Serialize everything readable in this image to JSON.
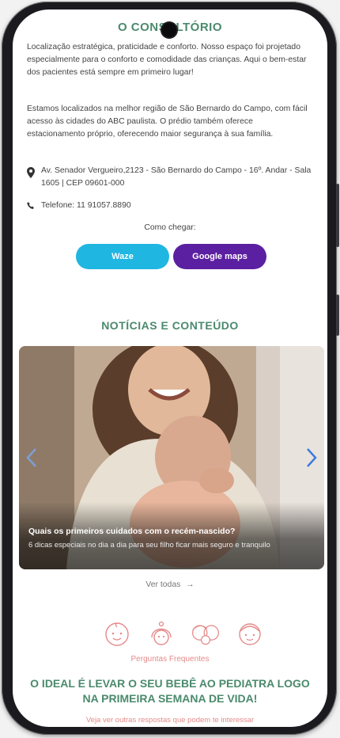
{
  "consultorio": {
    "title": "O CONSULTÓRIO",
    "p1": "Localização estratégica, praticidade e conforto. Nosso espaço foi projetado especialmente para o conforto e comodidade das crianças. Aqui o bem-estar dos pacientes está sempre em primeiro lugar!",
    "p2": "Estamos localizados na melhor região de São Bernardo do Campo, com fácil acesso às cidades do ABC paulista. O prédio também oferece estacionamento próprio, oferecendo maior segurança à sua família.",
    "address": "Av. Senador Vergueiro,2123 - São Bernardo do Campo - 16º. Andar - Sala 1605 | CEP 09601-000",
    "phone": "Telefone: 11 91057.8890",
    "how_to": "Como chegar:",
    "waze_label": "Waze",
    "maps_label": "Google maps"
  },
  "news": {
    "title": "NOTÍCIAS E CONTEÚDO",
    "card_title": "Quais os primeiros cuidados com o recém-nascido?",
    "card_desc": "6 dicas especiais no dia a dia para seu filho ficar mais seguro e tranquilo",
    "see_all": "Ver todas",
    "see_all_arrow": "→"
  },
  "faq": {
    "label": "Perguntas Frequentes",
    "headline": "O IDEAL É LEVAR O SEU BEBÊ AO PEDIATRA LOGO NA PRIMEIRA SEMANA DE VIDA!",
    "subline": "Veja ver outras respostas que podem te interessar"
  },
  "colors": {
    "accent_green": "#4a8a6c",
    "waze": "#1fb6e2",
    "maps": "#5b1fa1",
    "faq_pink": "#e58a8a"
  },
  "icons": [
    "baby-face-icon",
    "baby-bonnet-icon",
    "family-faces-icon",
    "toddler-face-icon"
  ]
}
